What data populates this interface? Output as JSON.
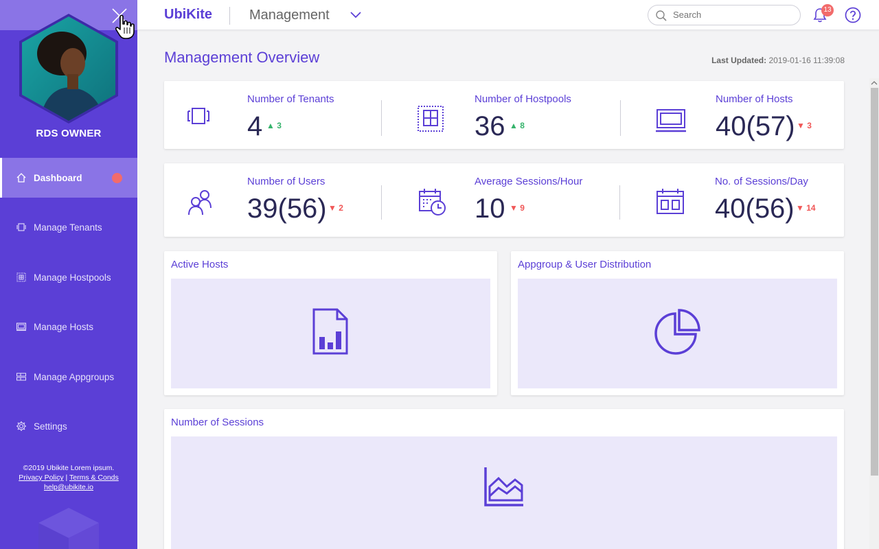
{
  "app": {
    "brand": "UbiKite",
    "section": "Management"
  },
  "header": {
    "search_placeholder": "Search",
    "notification_count": "13"
  },
  "sidebar": {
    "owner": "RDS OWNER",
    "items": [
      {
        "label": "Dashboard",
        "icon": "home-icon",
        "active": true
      },
      {
        "label": "Manage Tenants",
        "icon": "tenants-icon"
      },
      {
        "label": "Manage Hostpools",
        "icon": "hostpool-icon"
      },
      {
        "label": "Manage Hosts",
        "icon": "monitor-icon"
      },
      {
        "label": "Manage Appgroups",
        "icon": "appgroup-icon"
      },
      {
        "label": "Settings",
        "icon": "gear-icon"
      }
    ],
    "footer": {
      "copyright": "©2019 Ubikite Lorem ipsum.",
      "privacy": "Privacy Policy",
      "sep": "|",
      "terms": "Terms & Conds",
      "email": "help@ubikite.io"
    }
  },
  "main": {
    "title": "Management Overview",
    "last_updated_label": "Last Updated:",
    "last_updated_value": "2019-01-16 11:39:08",
    "stats_row1": [
      {
        "label": "Number of Tenants",
        "value": "4",
        "delta": "3",
        "direction": "up",
        "icon": "tenants-icon"
      },
      {
        "label": "Number of Hostpools",
        "value": "36",
        "delta": "8",
        "direction": "up",
        "icon": "hostpool-icon"
      },
      {
        "label": "Number of Hosts",
        "value": "40(57)",
        "delta": "3",
        "direction": "down",
        "icon": "monitor-icon"
      }
    ],
    "stats_row2": [
      {
        "label": "Number of Users",
        "value": "39(56)",
        "delta": "2",
        "direction": "down",
        "icon": "users-icon"
      },
      {
        "label": "Average Sessions/Hour",
        "value": "10",
        "delta": "9",
        "direction": "down",
        "icon": "calendar-clock-icon"
      },
      {
        "label": "No. of Sessions/Day",
        "value": "40(56)",
        "delta": "14",
        "direction": "down",
        "icon": "calendar-icon"
      }
    ],
    "panels": {
      "active_hosts": "Active Hosts",
      "distribution": "Appgroup & User Distribution",
      "sessions": "Number of Sessions"
    }
  },
  "colors": {
    "accent": "#5b3fd6",
    "up": "#35b36b",
    "down": "#f05757",
    "panel_bg": "#ebe8fa"
  }
}
